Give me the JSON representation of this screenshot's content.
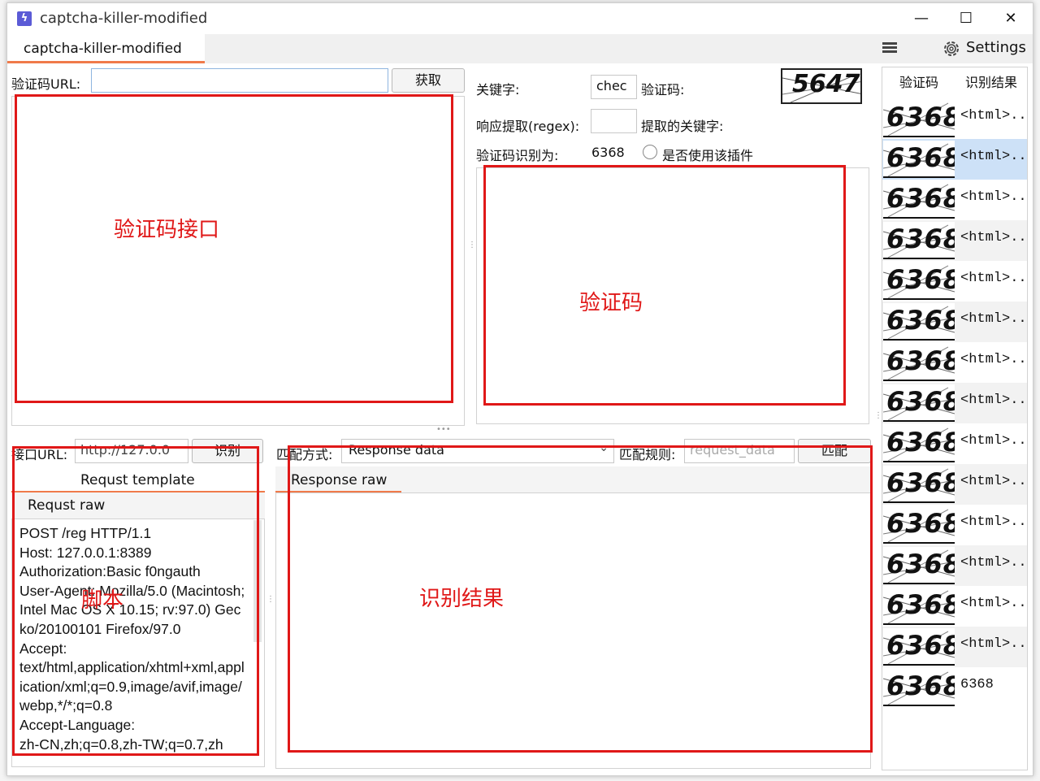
{
  "window": {
    "title": "captcha-killer-modified",
    "minimize": "—",
    "maximize": "☐",
    "close": "✕"
  },
  "tabbar": {
    "tab": "captcha-killer-modified",
    "settings_label": "Settings"
  },
  "captcha_source": {
    "url_label": "验证码URL:",
    "url_value": "",
    "fetch_button": "获取",
    "annotation": "验证码接口"
  },
  "captcha_view": {
    "keyword_label": "关键字:",
    "keyword_value": "chec",
    "captcha_label": "验证码:",
    "captcha_digits": "5647",
    "regex_label": "响应提取(regex):",
    "regex_value": "",
    "extracted_keyword_label": "提取的关键字:",
    "recognized_label": "验证码识别为:",
    "recognized_value": "6368",
    "use_plugin_label": "是否使用该插件",
    "annotation": "验证码"
  },
  "recognition_api": {
    "url_label": "接口URL:",
    "url_value": "http://127.0.0",
    "recognize_button": "识别",
    "template_tab": "Requst template",
    "raw_tab": "Requst raw",
    "raw_text": "POST /reg HTTP/1.1\nHost: 127.0.0.1:8389\nAuthorization:Basic f0ngauth\nUser-Agent: Mozilla/5.0 (Macintosh; Intel Mac OS X 10.15; rv:97.0) Gecko/20100101 Firefox/97.0\nAccept:\ntext/html,application/xhtml+xml,application/xml;q=0.9,image/avif,image/webp,*/*;q=0.8\nAccept-Language:\nzh-CN,zh;q=0.8,zh-TW;q=0.7,zh",
    "annotation": "脚本"
  },
  "response": {
    "match_mode_label": "匹配方式:",
    "match_mode_value": "Response data",
    "match_rule_label": "匹配规则:",
    "match_rule_placeholder": "request_data",
    "match_button": "匹配",
    "raw_tab": "Response raw",
    "annotation": "识别结果"
  },
  "history": {
    "col_captcha": "验证码",
    "col_result": "识别结果",
    "rows": [
      {
        "digits": "6368",
        "result": "<html>..."
      },
      {
        "digits": "6368",
        "result": "<html>..."
      },
      {
        "digits": "6368",
        "result": "<html>..."
      },
      {
        "digits": "6368",
        "result": "<html>..."
      },
      {
        "digits": "6368",
        "result": "<html>..."
      },
      {
        "digits": "6368",
        "result": "<html>..."
      },
      {
        "digits": "6368",
        "result": "<html>..."
      },
      {
        "digits": "6368",
        "result": "<html>..."
      },
      {
        "digits": "6368",
        "result": "<html>..."
      },
      {
        "digits": "6368",
        "result": "<html>..."
      },
      {
        "digits": "6368",
        "result": "<html>..."
      },
      {
        "digits": "6368",
        "result": "<html>..."
      },
      {
        "digits": "6368",
        "result": "<html>..."
      },
      {
        "digits": "6368",
        "result": "<html>..."
      },
      {
        "digits": "6368",
        "result": "6368"
      }
    ],
    "selected_index": 1
  }
}
